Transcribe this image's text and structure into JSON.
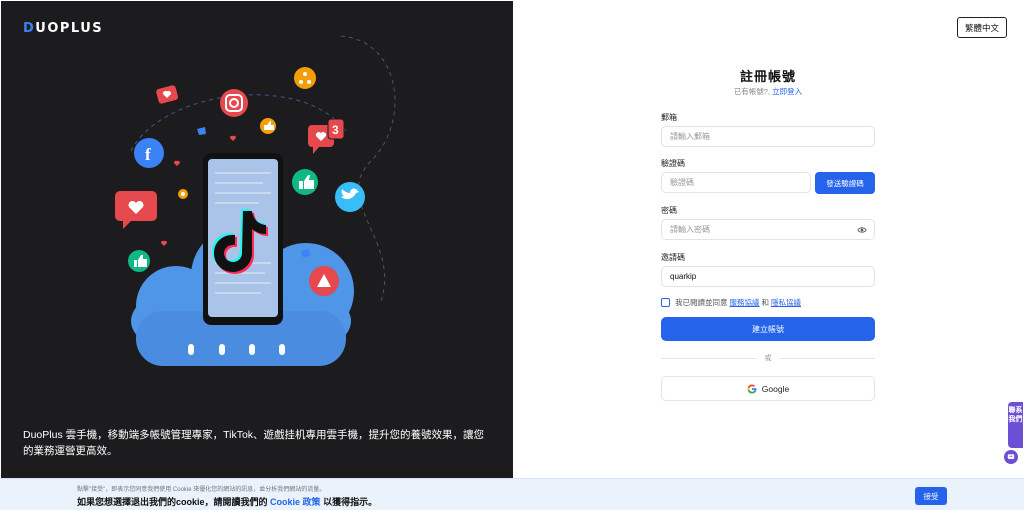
{
  "brand": {
    "logo_text": "DUOPLUS"
  },
  "left": {
    "tagline": "DuoPlus 雲手機，移動端多帳號管理專家，TikTok、遊戲挂机專用雲手機，提升您的養號效果，讓您的業務運營更高效。",
    "notification_count": "3"
  },
  "header": {
    "language_button": "繁體中文"
  },
  "form": {
    "title": "註冊帳號",
    "have_account_text": "已有帳號?,",
    "login_link": "立即登入",
    "email": {
      "label": "郵箱",
      "placeholder": "請輸入郵箱"
    },
    "code": {
      "label": "驗證碼",
      "placeholder": "驗證碼",
      "send_button": "發送驗證碼"
    },
    "password": {
      "label": "密碼",
      "placeholder": "請輸入密碼"
    },
    "invite": {
      "label": "邀請碼",
      "value": "quarkip"
    },
    "agree": {
      "text": "我已閱讀並同意",
      "terms_link": "服務協議",
      "and": "和",
      "privacy_link": "隱私協議"
    },
    "create_button": "建立帳號",
    "or_text": "或",
    "google_button": "Google"
  },
  "contact": {
    "label": "聯系我們"
  },
  "cookie_banner": {
    "notice": "點擊\"接受\"，即表示您同意我們使用 Cookie 來優化您的網站的訊息，並分析我們網站的流量。",
    "optout_prefix": "如果您想選擇退出我們的cookie，請閱讀我們的",
    "policy_link": "Cookie 政策",
    "optout_suffix": "以獲得指示。",
    "accept_button": "接受"
  },
  "colors": {
    "accent": "#2563eb",
    "dark_panel": "#1c1c1e",
    "contact_purple": "#6d4fd6",
    "cookie_bg": "#eaf2fc"
  }
}
